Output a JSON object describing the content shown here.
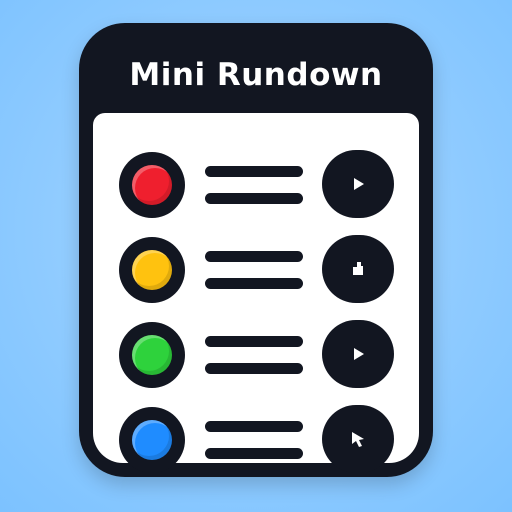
{
  "app": {
    "title": "Mini Rundown"
  },
  "items": [
    {
      "status_icon": "red-status-dot",
      "status_color": "#ef1f2e",
      "action_icon": "play-icon"
    },
    {
      "status_icon": "yellow-status-dot",
      "status_color": "#ffc20f",
      "action_icon": "trim-icon"
    },
    {
      "status_icon": "green-status-dot",
      "status_color": "#2ed23c",
      "action_icon": "play-icon"
    },
    {
      "status_icon": "blue-status-dot",
      "status_color": "#1f8cff",
      "action_icon": "cursor-icon"
    }
  ]
}
